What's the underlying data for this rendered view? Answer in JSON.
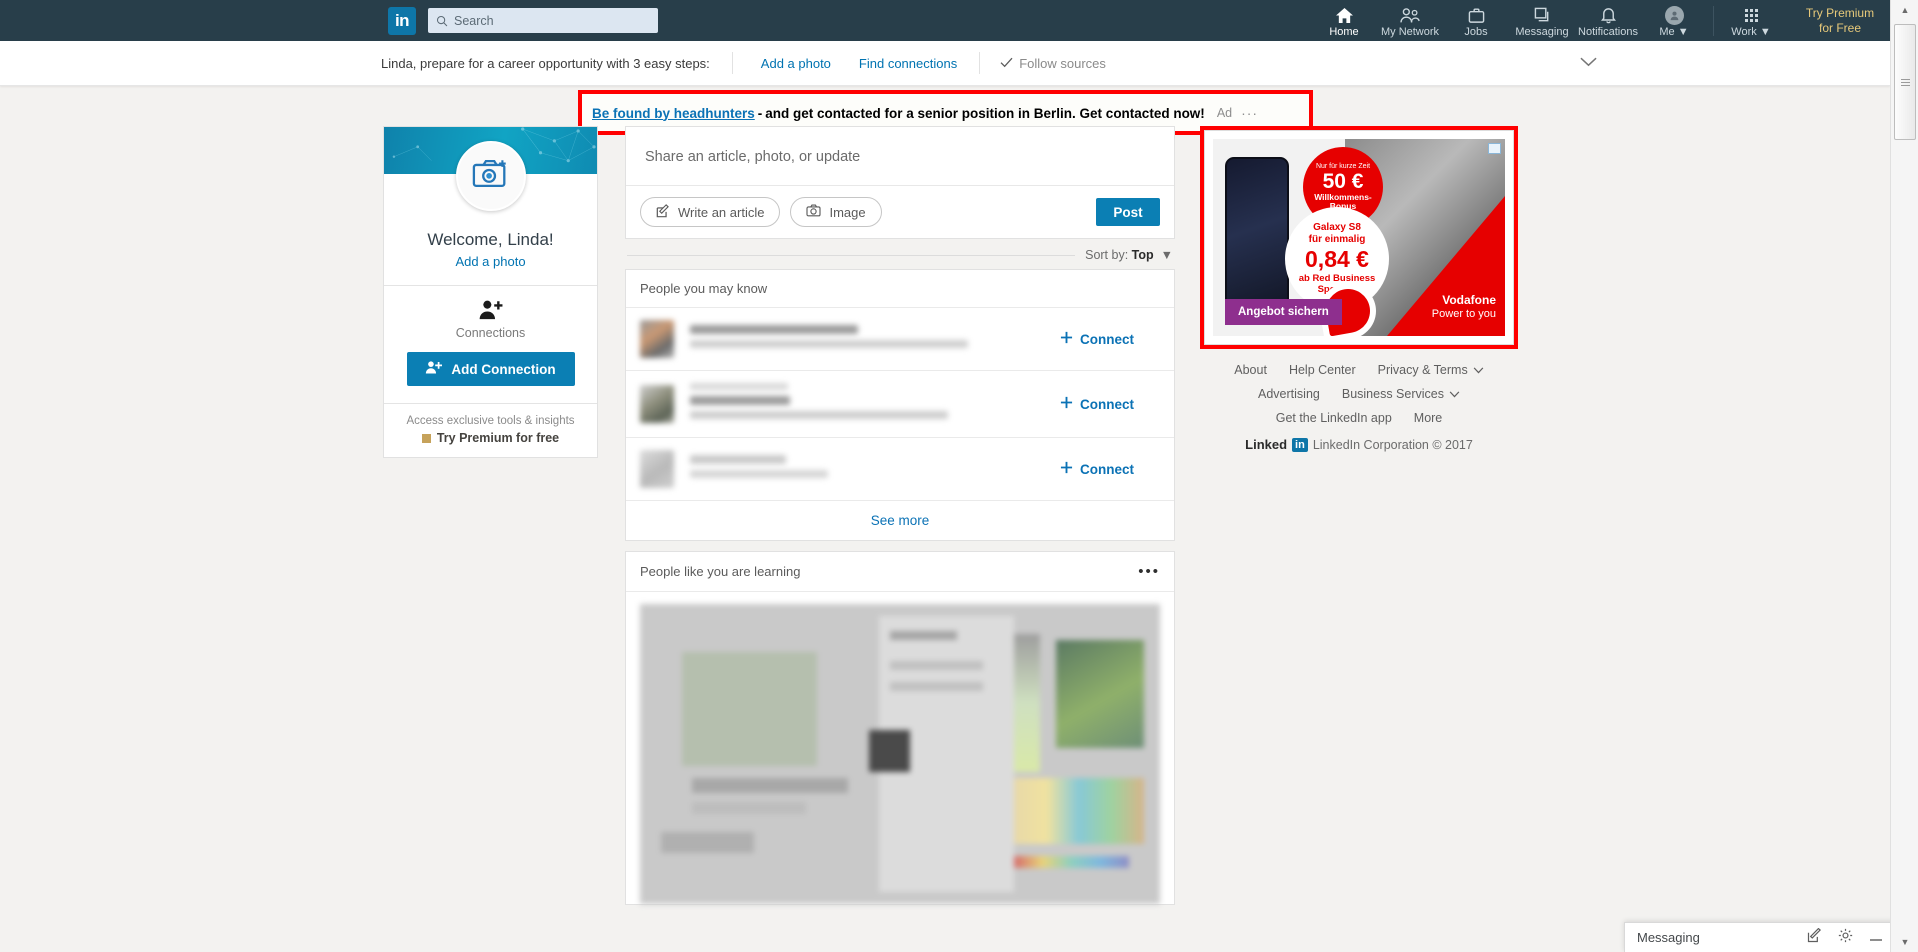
{
  "nav": {
    "logo_text": "in",
    "search_placeholder": "Search",
    "items": [
      {
        "label": "Home",
        "icon": "home-icon",
        "active": true
      },
      {
        "label": "My Network",
        "icon": "network-icon",
        "active": false
      },
      {
        "label": "Jobs",
        "icon": "briefcase-icon",
        "active": false
      },
      {
        "label": "Messaging",
        "icon": "messaging-icon",
        "active": false
      },
      {
        "label": "Notifications",
        "icon": "bell-icon",
        "active": false
      },
      {
        "label": "Me",
        "icon": "avatar-icon",
        "active": false
      }
    ],
    "work_label": "Work",
    "premium_line1": "Try Premium",
    "premium_line2": "for Free"
  },
  "tipbar": {
    "text": "Linda, prepare for a career opportunity with 3 easy steps:",
    "link1": "Add a photo",
    "link2": "Find connections",
    "done_item": "Follow sources"
  },
  "top_ad": {
    "link_text": "Be found by headhunters",
    "dash": "-",
    "body_text": "and get contacted for a senior position in Berlin. Get contacted now!",
    "ad_tag": "Ad",
    "menu": "···",
    "highlight_color": "#ff0000"
  },
  "profile": {
    "welcome": "Welcome, Linda!",
    "add_photo": "Add a photo",
    "connections_label": "Connections",
    "add_connection_button": "Add Connection",
    "premium_tagline": "Access exclusive tools & insights",
    "premium_link": "Try Premium for free"
  },
  "share": {
    "prompt": "Share an article, photo, or update",
    "write_article": "Write an article",
    "image": "Image",
    "post": "Post"
  },
  "sort": {
    "label": "Sort by:",
    "value": "Top"
  },
  "pymk": {
    "title": "People you may know",
    "connect_label": "Connect",
    "rows": [
      {
        "name_hidden": true,
        "subtitle_hidden": true
      },
      {
        "name_hidden": true,
        "subtitle_hidden": true
      },
      {
        "name_hidden": true,
        "subtitle_hidden": true
      }
    ],
    "see_more": "See more"
  },
  "learning": {
    "title": "People like you are learning",
    "menu": "•••"
  },
  "sidebar_ad": {
    "highlight_color": "#ff0000",
    "badge": "AdChoices",
    "burst_line1": "Nur für kurze Zeit",
    "burst_amount": "50 €",
    "burst_line3": "Willkommens-",
    "burst_line4": "Bonus",
    "offer_line1": "Galaxy S8",
    "offer_line2": "für einmalig",
    "offer_price": "0,84 €",
    "offer_line3": "ab  Red Business",
    "offer_line4": "Special+",
    "cta": "Angebot sichern",
    "brand": "Vodafone",
    "tagline": "Power to you"
  },
  "footer": {
    "links": [
      {
        "label": "About",
        "chevron": false
      },
      {
        "label": "Help Center",
        "chevron": false
      },
      {
        "label": "Privacy & Terms",
        "chevron": true
      },
      {
        "label": "Advertising",
        "chevron": false
      },
      {
        "label": "Business Services",
        "chevron": true
      },
      {
        "label": "Get the LinkedIn app",
        "chevron": false
      },
      {
        "label": "More",
        "chevron": false
      }
    ],
    "brand_word": "Linked",
    "brand_square": "in",
    "copyright": "LinkedIn Corporation © 2017"
  },
  "messaging_dock": {
    "title": "Messaging",
    "compose_icon": "compose-icon",
    "settings_icon": "gear-icon",
    "minimize_icon": "minimize-icon"
  },
  "colors": {
    "nav_bg": "#283e4a",
    "accent_blue": "#0073b1",
    "button_blue": "#0b7fb4",
    "page_bg": "#f3f2f0",
    "premium_gold": "#e7c97a",
    "vodafone_red": "#e60000"
  }
}
